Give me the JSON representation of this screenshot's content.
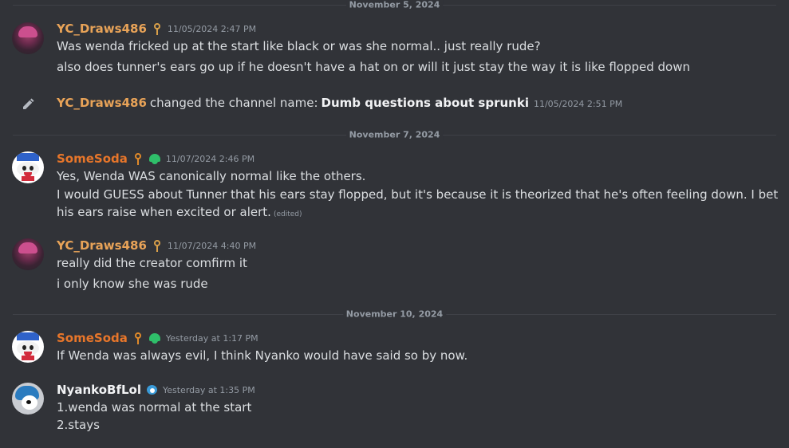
{
  "dividers": [
    "November 5, 2024",
    "November 7, 2024",
    "November 10, 2024"
  ],
  "messages": [
    {
      "username": "YC_Draws486",
      "timestamp": "11/05/2024 2:47 PM",
      "lines": [
        "Was wenda fricked up at the start like black or was she normal.. just really rude?",
        "also does tunner's ears go up if he doesn't have a hat on or will it just stay the way it is like flopped down"
      ]
    },
    {
      "username": "SomeSoda",
      "timestamp": "11/07/2024 2:46 PM",
      "lines": [
        "Yes, Wenda WAS canonically normal like the others.",
        "I would GUESS about Tunner that his ears stay flopped, but it's because it is theorized that he's often feeling down. I bet his ears raise when excited or alert."
      ],
      "edited_label": "(edited)"
    },
    {
      "username": "YC_Draws486",
      "timestamp": "11/07/2024 4:40 PM",
      "lines": [
        "really did the creator comfirm it",
        "i only know she was rude"
      ]
    },
    {
      "username": "SomeSoda",
      "timestamp": "Yesterday at 1:17 PM",
      "lines": [
        "If Wenda was always evil, I think Nyanko would have said so by now."
      ]
    },
    {
      "username": "NyankoBfLol",
      "timestamp": "Yesterday at 1:35 PM",
      "lines": [
        "1.wenda was normal at the start",
        "2.stays"
      ]
    }
  ],
  "system": {
    "username": "YC_Draws486",
    "action": "changed the channel name:",
    "channel_name": "Dumb questions about sprunki",
    "timestamp": "11/05/2024 2:51 PM",
    "icon": "pencil-icon"
  },
  "colors": {
    "background": "#313338",
    "yc_name": "#e8a358",
    "soda_name": "#e8762a",
    "nyanko_name": "#f2f3f5",
    "text": "#dbdee1",
    "muted": "#949ba4"
  }
}
